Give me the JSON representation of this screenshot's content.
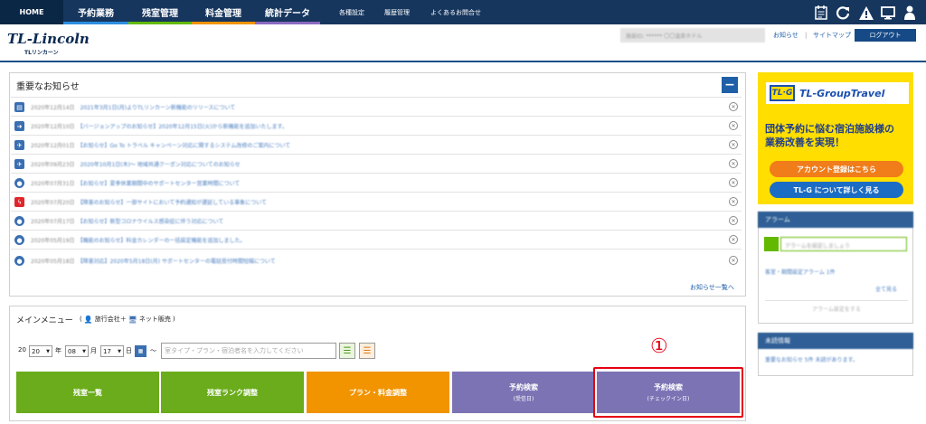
{
  "nav": {
    "home": "HOME",
    "main_items": [
      {
        "label": "予約業務",
        "color": "#2e8ee0"
      },
      {
        "label": "残室管理",
        "color": "#62b900"
      },
      {
        "label": "料金管理",
        "color": "#f29400"
      },
      {
        "label": "統計データ",
        "color": "#8a6ac0"
      }
    ],
    "sub_items": [
      "各種設定",
      "履歴管理",
      "よくあるお問合せ"
    ],
    "icons": [
      "notepad-icon",
      "refresh-icon",
      "warning-icon",
      "monitor-icon",
      "user-icon"
    ]
  },
  "header": {
    "logo": "TL-Lincoln",
    "logo_sub": "TLリンカーン",
    "user_info": "施設ID: ****** 〇〇温泉ホテル",
    "links": [
      "お知らせ",
      "サイトマップ"
    ],
    "logout": "ログアウト"
  },
  "notices": {
    "title": "重要なお知らせ",
    "collapse": "−",
    "items": [
      {
        "icon": "building-icon",
        "color": "#3a6fb2",
        "date": "2020年12月14日",
        "text": "2021年3月1日(月)よりTLリンカーン新機能のリリースについて"
      },
      {
        "icon": "arrow-icon",
        "color": "#3a6fb2",
        "date": "2020年12月10日",
        "text": "【バージョンアップのお知らせ】2020年12月15日(火)から新機能を追加いたします。"
      },
      {
        "icon": "rocket-icon",
        "color": "#3a6fb2",
        "date": "2020年12月01日",
        "text": "【お知らせ】Go To トラベル キャンペーン対応に関するシステム改修のご案内について"
      },
      {
        "icon": "rocket-icon",
        "color": "#3a6fb2",
        "date": "2020年09月23日",
        "text": "2020年10月1日(木)〜 地域共通クーポン対応についてのお知らせ"
      },
      {
        "icon": "chat-icon",
        "color": "#3a6fb2",
        "date": "2020年07月31日",
        "text": "【お知らせ】夏季休業期間中のサポートセンター営業時間について"
      },
      {
        "icon": "bolt-icon",
        "color": "#e0262b",
        "date": "2020年07月20日",
        "text": "【障害のお知らせ】一部サイトにおいて予約通知が遅延している事象について"
      },
      {
        "icon": "chat-icon",
        "color": "#3a6fb2",
        "date": "2020年07月17日",
        "text": "【お知らせ】新型コロナウイルス感染症に伴う対応について"
      },
      {
        "icon": "chat-icon",
        "color": "#3a6fb2",
        "date": "2020年05月19日",
        "text": "【機能のお知らせ】料金カレンダーの一括設定機能を追加しました。"
      },
      {
        "icon": "chat-icon",
        "color": "#3a6fb2",
        "date": "2020年05月18日",
        "text": "【障害対応】2020年5月18日(月) サポートセンターの電話受付時間短縮について"
      }
    ],
    "more": "お知らせ一覧へ"
  },
  "main_menu": {
    "title": "メインメニュー",
    "legend_open": "(",
    "legend_travel": "旅行会社＋",
    "legend_net": "ネット販売",
    "legend_close": ")",
    "year_prefix": "20",
    "year": "20",
    "year_label": "年",
    "month": "08",
    "month_label": "月",
    "day": "17",
    "day_label": "日",
    "tilde": "〜",
    "search_placeholder": "室タイプ・プラン・宿泊者名を入力してください",
    "buttons": [
      {
        "label": "残室一覧",
        "sub": "",
        "color": "#6aac1b"
      },
      {
        "label": "残室ランク調整",
        "sub": "",
        "color": "#6aac1b"
      },
      {
        "label": "プラン・料金調整",
        "sub": "",
        "color": "#f29400"
      },
      {
        "label": "予約検索",
        "sub": "(受信日)",
        "color": "#7c73b4"
      },
      {
        "label": "予約検索",
        "sub": "(チェックイン日)",
        "color": "#7c73b4"
      }
    ],
    "annotation": "①",
    "annotation_color": "#e60012"
  },
  "ad": {
    "logo_mark": "TL·G",
    "logo_text": "TL-GroupTravel",
    "copy_line1": "団体予約に悩む宿泊施設様の",
    "copy_line2": "業務改善を実現！",
    "btn_register": "アカウント登録はこちら",
    "btn_register_color": "#f07c1a",
    "btn_about": "TL-G について詳しく見る",
    "btn_about_color": "#1b6cc4"
  },
  "alarm": {
    "title": "アラーム",
    "input_placeholder": "アラームを設定しましょう",
    "link": "客室・期間設定アラーム 1件",
    "side_link": "全て見る",
    "setting": "アラーム設定をする"
  },
  "unread": {
    "title": "未読情報",
    "text": "重要なお知らせ 5件 未読があります。"
  }
}
